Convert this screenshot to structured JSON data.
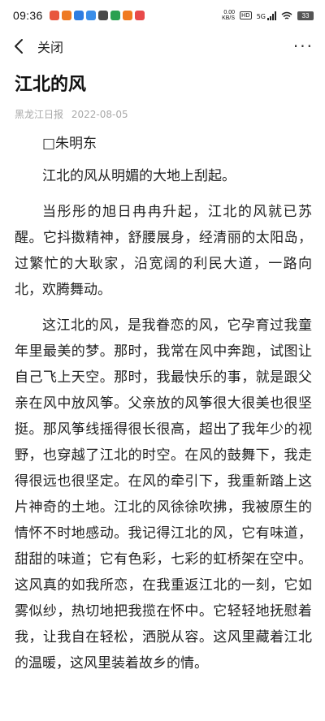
{
  "status_bar": {
    "time": "09:36",
    "net_speed_top": "0.00",
    "net_speed_bottom": "KB/S",
    "hd": "HD",
    "network": "5G",
    "battery": "33",
    "notif_colors": [
      "#e8563f",
      "#ee7a23",
      "#2f7de1",
      "#3b8ee8",
      "#4a4a4a",
      "#2aa050",
      "#f07a1e",
      "#e84a4a"
    ]
  },
  "nav": {
    "back_icon": "chevron-left-icon",
    "close_label": "关闭",
    "more_label": "···"
  },
  "article": {
    "title": "江北的风",
    "source": "黑龙江日报",
    "date": "2022-08-05",
    "paragraphs": [
      "□朱明东",
      "江北的风从明媚的大地上刮起。",
      "当彤彤的旭日冉冉升起，江北的风就已苏醒。它抖擞精神，舒腰展身，经清丽的太阳岛，过繁忙的大耿家，沿宽阔的利民大道，一路向北，欢腾舞动。",
      "这江北的风，是我眷恋的风，它孕育过我童年里最美的梦。那时，我常在风中奔跑，试图让自己飞上天空。那时，我最快乐的事，就是跟父亲在风中放风筝。父亲放的风筝很大很美也很坚挺。那风筝线摇得很长很高，超出了我年少的视野，也穿越了江北的时空。在风的鼓舞下，我走得很远也很坚定。在风的牵引下，我重新踏上这片神奇的土地。江北的风徐徐吹拂，我被原生的情怀不时地感动。我记得江北的风，它有味道，甜甜的味道；它有色彩，七彩的虹桥架在空中。这风真的如我所恋，在我重返江北的一刻，它如雾似纱，热切地把我揽在怀中。它轻轻地抚慰着我，让我自在轻松，洒脱从容。这风里藏着江北的温暖，这风里装着故乡的情。"
    ]
  }
}
